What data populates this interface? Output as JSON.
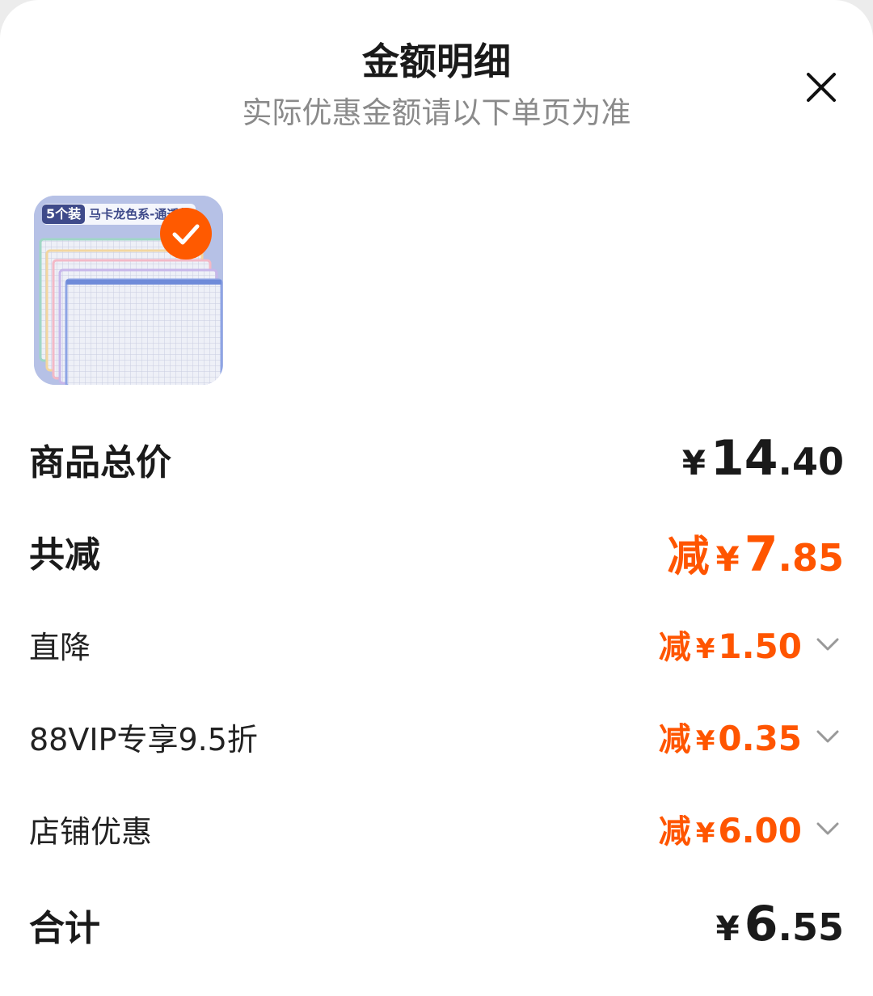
{
  "header": {
    "title": "金额明细",
    "subtitle": "实际优惠金额请以下单页为准"
  },
  "product": {
    "badge_count": "5个装",
    "badge_text": "马卡龙色系-通透款",
    "selected": true
  },
  "rows": {
    "total_price": {
      "label": "商品总价",
      "currency": "¥",
      "int": "14",
      "dec": ".40"
    },
    "total_reduce": {
      "label": "共减",
      "prefix": "减",
      "currency": "¥",
      "int": "7",
      "dec": ".85"
    },
    "direct_drop": {
      "label": "直降",
      "prefix": "减",
      "currency": "¥",
      "amount": "1.50"
    },
    "vip": {
      "label": "88VIP专享9.5折",
      "prefix": "减",
      "currency": "¥",
      "amount": "0.35"
    },
    "store": {
      "label": "店铺优惠",
      "prefix": "减",
      "currency": "¥",
      "amount": "6.00"
    },
    "sum": {
      "label": "合计",
      "currency": "¥",
      "int": "6",
      "dec": ".55"
    }
  },
  "icons": {
    "close": "close-icon",
    "check": "checkmark-icon",
    "chevron": "chevron-down-icon"
  },
  "colors": {
    "accent": "#ff5500",
    "text": "#1a1a1a",
    "subtext": "#8a8a8a"
  }
}
